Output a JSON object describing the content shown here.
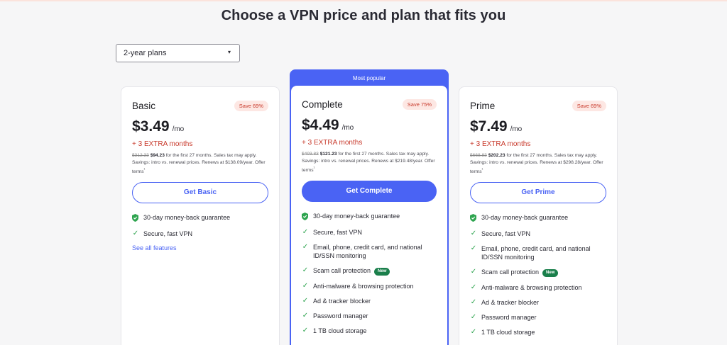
{
  "header": {
    "title": "Choose a VPN price and plan that fits you"
  },
  "plan_selector": {
    "value": "2-year plans",
    "arrow": "▾"
  },
  "popular_label": "Most popular",
  "plans": [
    {
      "name": "Basic",
      "save": "Save 69%",
      "price": "$3.49",
      "per": "/mo",
      "extra": "+ 3 EXTRA months",
      "old_price": "$312.33",
      "new_price": "$94.23",
      "fine_text": " for the first 27 months. Sales tax may apply. Savings: intro vs. renewal prices. Renews at $138.09/year. Offer terms",
      "button": "Get Basic",
      "guarantee": "30-day money-back guarantee",
      "features": [
        "Secure, fast VPN"
      ],
      "see_all": "See all features"
    },
    {
      "name": "Complete",
      "save": "Save 75%",
      "price": "$4.49",
      "per": "/mo",
      "extra": "+ 3 EXTRA months",
      "old_price": "$493.83",
      "new_price": "$121.23",
      "fine_text": " for the first 27 months. Sales tax may apply. Savings: intro vs. renewal prices. Renews at $219.48/year. Offer terms",
      "button": "Get Complete",
      "guarantee": "30-day money-back guarantee",
      "features": [
        "Secure, fast VPN",
        "Email, phone, credit card, and national ID/SSN monitoring",
        "Scam call protection",
        "Anti-malware & browsing protection",
        "Ad & tracker blocker",
        "Password manager",
        "1 TB cloud storage"
      ],
      "new_badge": "New"
    },
    {
      "name": "Prime",
      "save": "Save 69%",
      "price": "$7.49",
      "per": "/mo",
      "extra": "+ 3 EXTRA months",
      "old_price": "$668.83",
      "new_price": "$202.23",
      "fine_text": " for the first 27 months. Sales tax may apply. Savings: intro vs. renewal prices. Renews at $298.28/year. Offer terms",
      "button": "Get Prime",
      "guarantee": "30-day money-back guarantee",
      "features": [
        "Secure, fast VPN",
        "Email, phone, credit card, and national ID/SSN monitoring",
        "Scam call protection",
        "Anti-malware & browsing protection",
        "Ad & tracker blocker",
        "Password manager",
        "1 TB cloud storage"
      ],
      "new_badge": "New"
    }
  ],
  "footnote_mark": "¹",
  "colors": {
    "accent": "#4a63f4",
    "save": "#c8392b",
    "check": "#2ea44f",
    "new_badge": "#1a7f4b"
  }
}
